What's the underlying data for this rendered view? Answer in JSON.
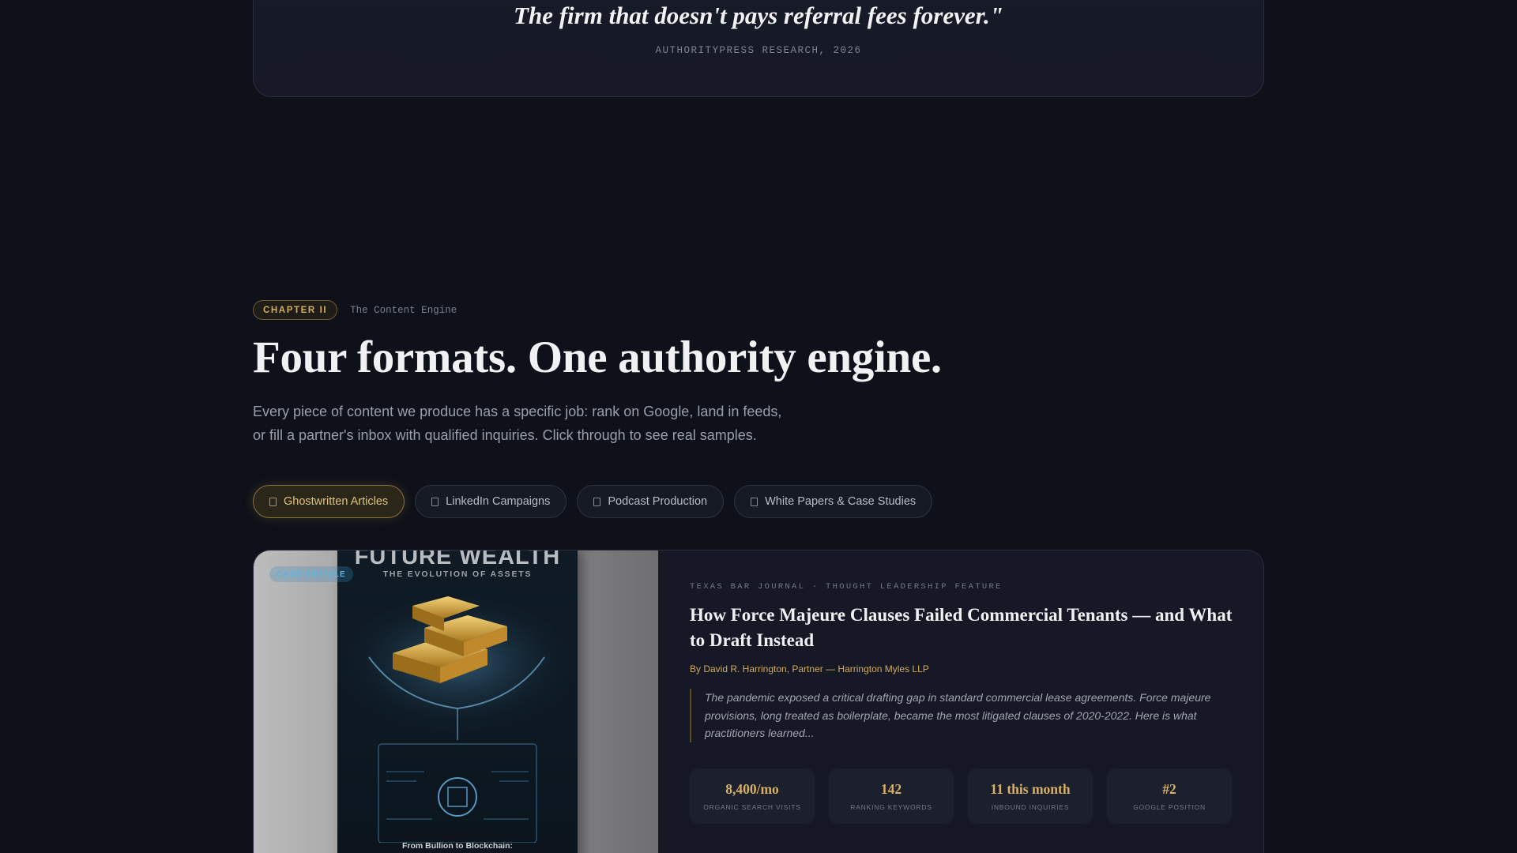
{
  "quote": {
    "text": "The firm that doesn't pays referral fees forever.\"",
    "source": "AUTHORITYPRESS RESEARCH, 2026"
  },
  "chapter": {
    "badge": "CHAPTER II",
    "subtitle": "The Content Engine",
    "headline": "Four formats. One authority engine.",
    "intro_line1": "Every piece of content we produce has a specific job: rank on Google, land in feeds,",
    "intro_line2": "or fill a partner's inbox with qualified inquiries. Click through to see real samples."
  },
  "tabs": [
    {
      "label": "Ghostwritten Articles",
      "icon": "document-icon",
      "active": true
    },
    {
      "label": "LinkedIn Campaigns",
      "icon": "document-icon",
      "active": false
    },
    {
      "label": "Podcast Production",
      "icon": "document-icon",
      "active": false
    },
    {
      "label": "White Papers & Case Studies",
      "icon": "document-icon",
      "active": false
    }
  ],
  "feature": {
    "image": {
      "pill": "CASE ARTICLE",
      "book_title": "FUTURE WEALTH",
      "book_subtitle": "THE EVOLUTION OF ASSETS",
      "book_footer": "From Bullion to Blockchain:"
    },
    "kicker": "TEXAS BAR JOURNAL · THOUGHT LEADERSHIP FEATURE",
    "title": "How Force Majeure Clauses Failed Commercial Tenants — and What to Draft Instead",
    "byline": "By David R. Harrington, Partner — Harrington Myles LLP",
    "excerpt": "The pandemic exposed a critical drafting gap in standard commercial lease agreements. Force majeure provisions, long treated as boilerplate, became the most litigated clauses of 2020-2022. Here is what practitioners learned...",
    "stats": [
      {
        "value": "8,400/mo",
        "label": "ORGANIC SEARCH VISITS"
      },
      {
        "value": "142",
        "label": "RANKING KEYWORDS"
      },
      {
        "value": "11 this month",
        "label": "INBOUND INQUIRIES"
      },
      {
        "value": "#2",
        "label": "GOOGLE POSITION"
      }
    ]
  },
  "colors": {
    "background": "#0e1119",
    "accent_gold": "#d4ad5e",
    "card": "#161925"
  }
}
